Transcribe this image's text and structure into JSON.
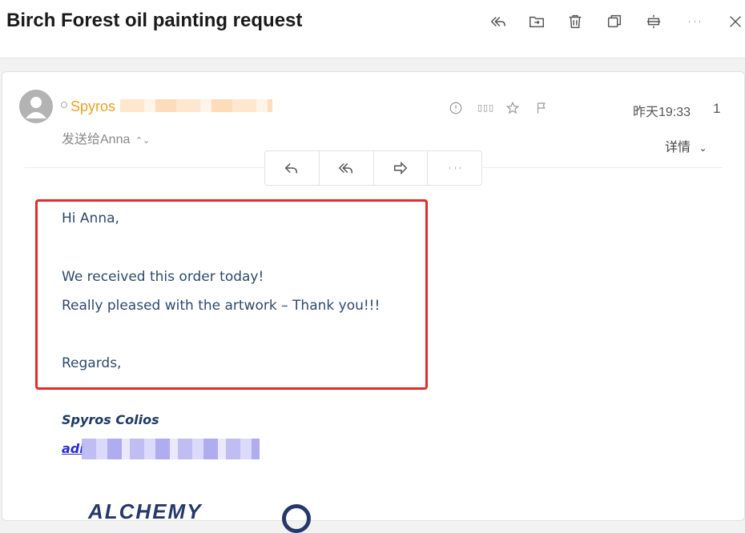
{
  "header": {
    "subject": "Birch Forest oil painting request",
    "icons": [
      "reply-all-icon",
      "move-folder-icon",
      "trash-icon",
      "copy-window-icon",
      "expand-icon",
      "more-icon",
      "close-icon"
    ]
  },
  "message": {
    "sender_name": "Spyros",
    "recipient": "发送给Anna",
    "date": "昨天19:33",
    "count": "1",
    "details_label": "详情",
    "small_glyph": "▯▯▯",
    "actions": [
      "reply-icon",
      "reply-all-icon",
      "forward-icon",
      "more-icon"
    ]
  },
  "body": {
    "greeting": "Hi Anna,",
    "line1": "We received this order today!",
    "line2": "Really pleased with the artwork – Thank you!!!",
    "closing": "Regards,"
  },
  "signature": {
    "name": "Spyros Colios",
    "link_prefix": "adi",
    "logo_text": "ALCHEMY"
  },
  "colors": {
    "sender": "#f0a020",
    "body_text": "#2e4a6b",
    "highlight": "#e52a2a",
    "signature": "#1f3a62",
    "link": "#2a2ad8"
  }
}
